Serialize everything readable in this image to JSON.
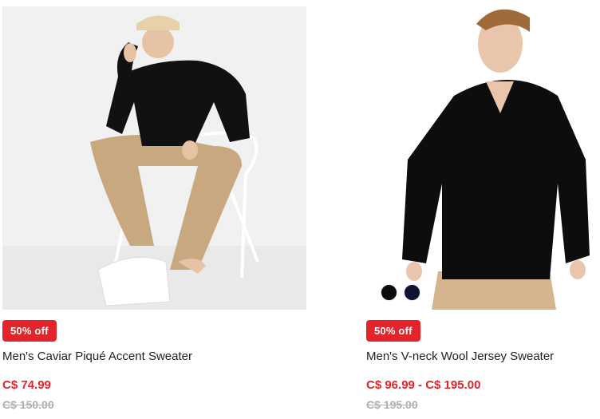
{
  "products": [
    {
      "badge": "50% off",
      "name": "Men's Caviar Piqué Accent Sweater",
      "price": "C$ 74.99",
      "original_price": "C$ 150.00",
      "image": "model-sitting-black-sweater-khaki-pants"
    },
    {
      "badge": "50% off",
      "name": "Men's V-neck Wool Jersey Sweater",
      "price": "C$ 96.99 - C$ 195.00",
      "original_price": "C$ 195.00",
      "image": "model-standing-black-vneck-sweater",
      "swatches": [
        "#0b0b0b",
        "#0f1430"
      ]
    }
  ],
  "colors": {
    "sale_red": "#e4242a",
    "text": "#222222",
    "strike": "#b0b0b0"
  }
}
